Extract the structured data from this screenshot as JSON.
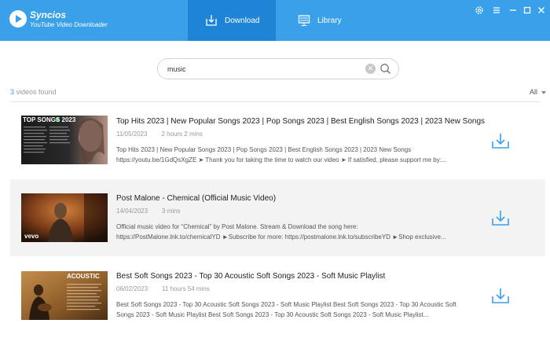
{
  "app": {
    "name": "Syncios",
    "subtitle": "YouTube Video Downloader"
  },
  "tabs": [
    {
      "label": "Download",
      "active": true,
      "icon": "download-tray-icon"
    },
    {
      "label": "Library",
      "active": false,
      "icon": "monitor-icon"
    }
  ],
  "window_controls": [
    "settings-icon",
    "menu-icon",
    "minimize-icon",
    "maximize-icon",
    "close-icon"
  ],
  "search": {
    "value": "music"
  },
  "results": {
    "count": "3",
    "label": " videos found",
    "filter": "All"
  },
  "videos": [
    {
      "title": "Top Hits 2023 | New Popular Songs 2023 | Pop Songs 2023 | Best English Songs 2023 | 2023 New Songs",
      "date": "11/05/2023",
      "duration": "2 hours 2 mins",
      "desc1": "Top Hits 2023 | New Popular Songs 2023 | Pop Songs 2023 | Best English Songs 2023 | 2023 New Songs",
      "desc2": "https://youtu.be/1GdQsXgZE ➤ Thank you for taking the time to watch our video ➤ If satisfied, please support me by:...",
      "thumb_text": "TOP SONGS 2023"
    },
    {
      "title": "Post Malone - Chemical (Official Music Video)",
      "date": "14/04/2023",
      "duration": "3 mins",
      "desc1": "Official music video for “Chemical” by Post Malone. Stream & Download the song here:",
      "desc2": "https://PostMalone.lnk.to/chemicalYD ►Subscribe for more: https://postmalone.lnk.to/subscribeYD ►Shop exclusive...",
      "thumb_text": "vevo"
    },
    {
      "title": "Best Soft Songs 2023 - Top 30 Acoustic Soft Songs 2023 - Soft Music Playlist",
      "date": "06/02/2023",
      "duration": "11 hours 54 mins",
      "desc1": "Best Soft Songs 2023 - Top 30 Acoustic Soft Songs 2023 - Soft Music Playlist Best Soft Songs 2023 - Top 30 Acoustic Soft",
      "desc2": "Songs 2023 - Soft Music Playlist Best Soft Songs 2023 - Top 30 Acoustic Soft Songs 2023 - Soft Music Playlist...",
      "thumb_text": "ACOUSTIC"
    }
  ],
  "colors": {
    "accent": "#3aa0ea",
    "active_tab": "#1d84d6",
    "row_alt": "#f3f3f3"
  }
}
